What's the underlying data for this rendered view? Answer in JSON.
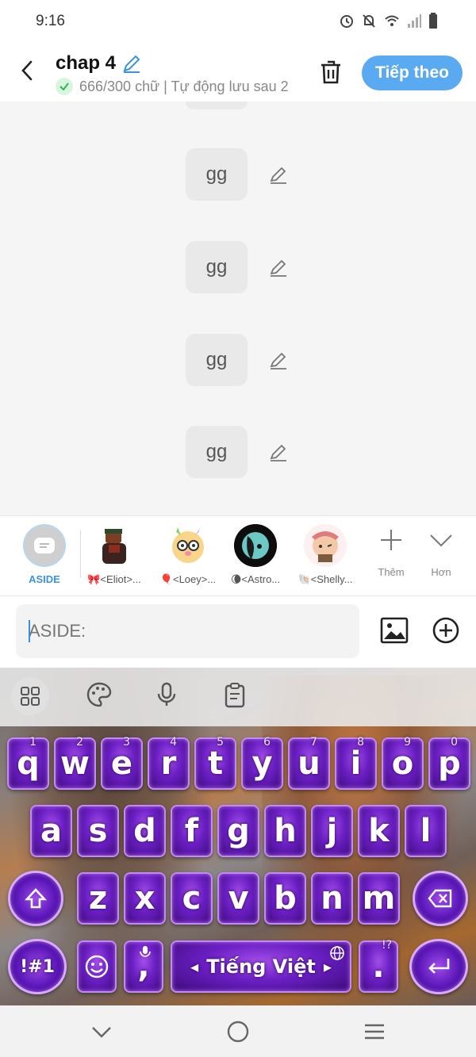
{
  "status_bar": {
    "time": "9:16",
    "icons": [
      "alarm-icon",
      "mute-icon",
      "wifi-icon",
      "signal-icon",
      "battery-icon"
    ]
  },
  "header": {
    "title": "chap 4",
    "subtitle": "666/300 chữ | Tự động lưu sau 2",
    "next_label": "Tiếp theo",
    "accent_color": "#5aaaf2"
  },
  "messages": [
    {
      "text": "gg"
    },
    {
      "text": "gg"
    },
    {
      "text": "gg"
    },
    {
      "text": "gg"
    }
  ],
  "characters": [
    {
      "name": "ASIDE"
    },
    {
      "name": "🎀<Eliot>..."
    },
    {
      "name": "🎈<Loey>..."
    },
    {
      "name": "🌘<Astro..."
    },
    {
      "name": "🐚<Shelly..."
    }
  ],
  "char_tools": {
    "add_label": "Thêm",
    "more_label": "Hơn"
  },
  "input": {
    "placeholder": "ASIDE:"
  },
  "keyboard": {
    "row1": [
      {
        "key": "q",
        "hint": "1"
      },
      {
        "key": "w",
        "hint": "2"
      },
      {
        "key": "e",
        "hint": "3"
      },
      {
        "key": "r",
        "hint": "4"
      },
      {
        "key": "t",
        "hint": "5"
      },
      {
        "key": "y",
        "hint": "6"
      },
      {
        "key": "u",
        "hint": "7"
      },
      {
        "key": "i",
        "hint": "8"
      },
      {
        "key": "o",
        "hint": "9"
      },
      {
        "key": "p",
        "hint": "0"
      }
    ],
    "row2": [
      "a",
      "s",
      "d",
      "f",
      "g",
      "h",
      "j",
      "k",
      "l"
    ],
    "row3": [
      "z",
      "x",
      "c",
      "v",
      "b",
      "n",
      "m"
    ],
    "symbols_label": "!#1",
    "comma_label": ",",
    "space_label": "Tiếng Việt",
    "punct_hint": "!?",
    "period_label": "."
  }
}
